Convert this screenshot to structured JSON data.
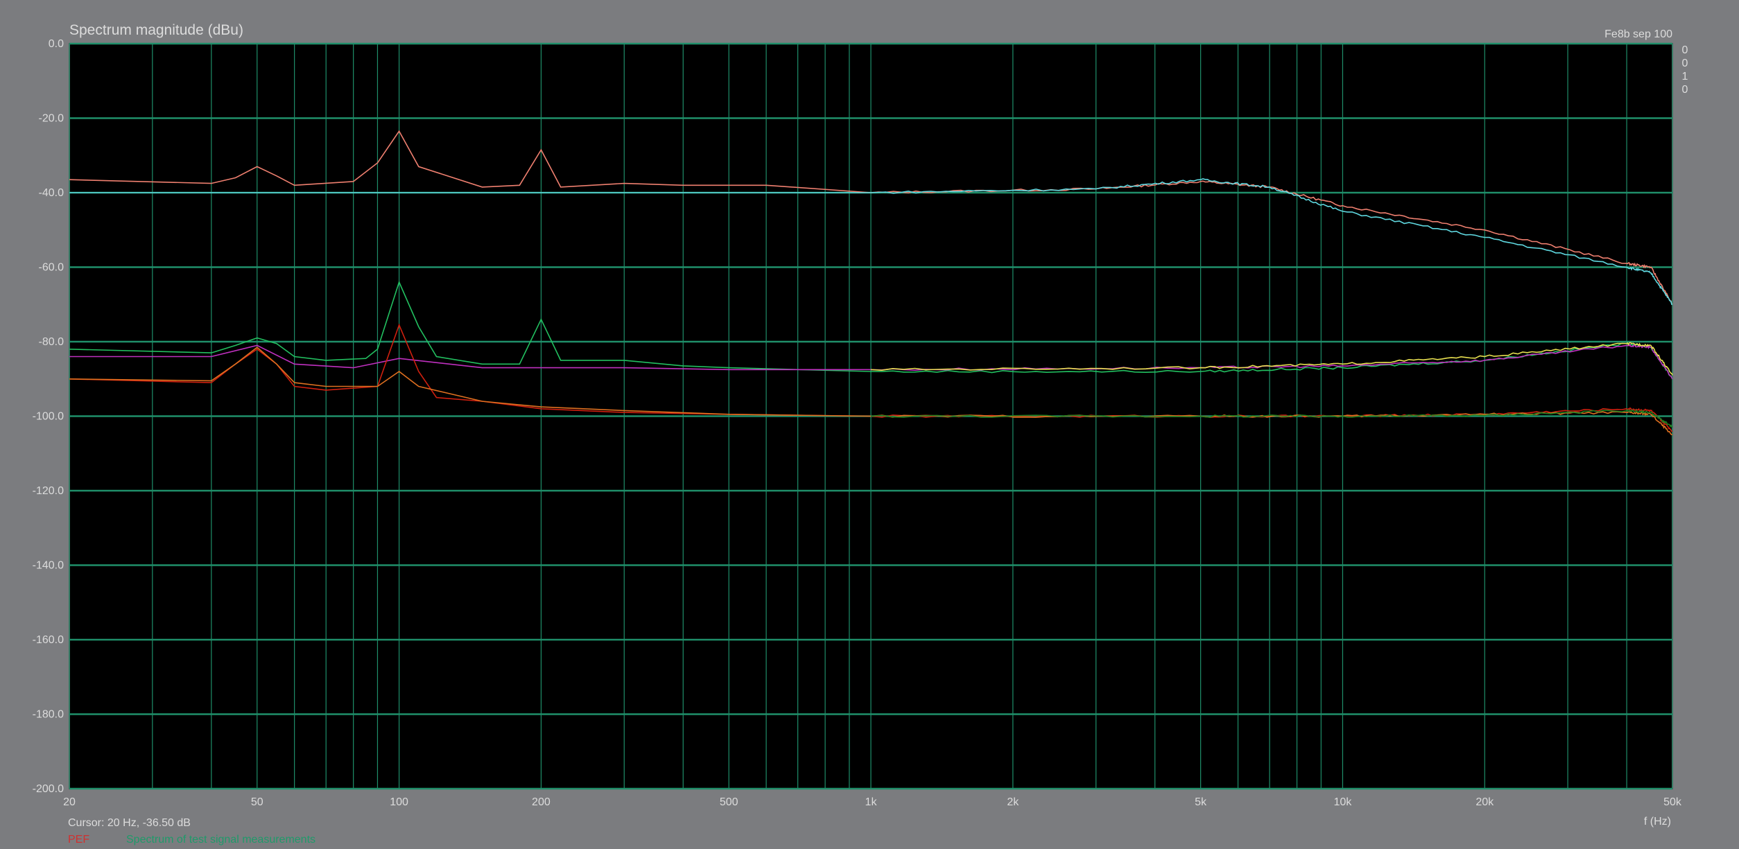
{
  "window": {
    "title": "Spectrum magnitude (dBu)",
    "top_right_label": "Fe8b sep 100"
  },
  "chart_data": {
    "type": "line",
    "title": "Spectrum magnitude (dBu)",
    "xlabel": "f (Hz)",
    "ylabel": "",
    "x_scale": "log",
    "xlim": [
      20,
      50000
    ],
    "ylim": [
      -200,
      0
    ],
    "x_tick_labels": [
      "20",
      "50",
      "100",
      "200",
      "500",
      "1k",
      "2k",
      "5k",
      "10k",
      "20k",
      "50k"
    ],
    "x_tick_values": [
      20,
      50,
      100,
      200,
      500,
      1000,
      2000,
      5000,
      10000,
      20000,
      50000
    ],
    "y_tick_labels": [
      "0.0",
      "-20.0",
      "-40.0",
      "-60.0",
      "-80.0",
      "-100.0",
      "-120.0",
      "-140.0",
      "-160.0",
      "-180.0",
      "-200.0"
    ],
    "y_tick_values": [
      0,
      -20,
      -40,
      -60,
      -80,
      -100,
      -120,
      -140,
      -160,
      -180,
      -200
    ],
    "grid": true,
    "background": "#000000",
    "grid_color": "#1f8f6a",
    "series": [
      {
        "color": "#f08070",
        "x": [
          20,
          40,
          45,
          50,
          55,
          60,
          80,
          90,
          100,
          110,
          150,
          180,
          200,
          220,
          300,
          400,
          500,
          600,
          1000,
          3000,
          5000,
          7000,
          10000,
          20000,
          40000,
          45000,
          50000
        ],
        "y": [
          -36.5,
          -37.5,
          -36,
          -33,
          -35.5,
          -38,
          -37,
          -32,
          -23.5,
          -33,
          -38.5,
          -38,
          -28.5,
          -38.5,
          -37.5,
          -38,
          -38,
          -38,
          -40,
          -39,
          -37,
          -38.5,
          -43.5,
          -50,
          -59,
          -60,
          -70
        ]
      },
      {
        "color": "#5fd8e0",
        "x": [
          20,
          30,
          50,
          100,
          200,
          500,
          1000,
          3000,
          5000,
          7000,
          10000,
          20000,
          40000,
          45000,
          50000
        ],
        "y": [
          -40,
          -40,
          -40,
          -40,
          -40,
          -40,
          -40,
          -39,
          -36.5,
          -38.5,
          -45,
          -52,
          -60,
          -61.5,
          -70
        ]
      },
      {
        "color": "#22c060",
        "x": [
          20,
          40,
          45,
          50,
          55,
          60,
          70,
          85,
          90,
          100,
          110,
          120,
          150,
          180,
          200,
          220,
          300,
          400,
          500,
          1000,
          5000,
          10000,
          20000,
          40000,
          45000,
          50000
        ],
        "y": [
          -82,
          -83,
          -81,
          -79,
          -80.5,
          -84,
          -85,
          -84.5,
          -82,
          -64,
          -76,
          -84,
          -86,
          -86,
          -74,
          -85,
          -85,
          -86.5,
          -87,
          -88,
          -88,
          -87,
          -85,
          -80.5,
          -81.5,
          -90
        ]
      },
      {
        "color": "#c030c0",
        "x": [
          20,
          40,
          50,
          60,
          80,
          100,
          150,
          200,
          300,
          500,
          1000,
          5000,
          10000,
          20000,
          40000,
          45000,
          50000
        ],
        "y": [
          -84,
          -84,
          -81,
          -86,
          -87,
          -84.5,
          -87,
          -87,
          -87,
          -87.5,
          -87.5,
          -87,
          -86.5,
          -85,
          -81,
          -81.5,
          -90
        ]
      },
      {
        "color": "#e8e050",
        "x": [
          1000,
          5000,
          10000,
          20000,
          40000,
          45000,
          50000
        ],
        "y": [
          -87.5,
          -87,
          -86,
          -84,
          -80.5,
          -81,
          -89
        ]
      },
      {
        "color": "#d0200f",
        "x": [
          20,
          40,
          45,
          50,
          55,
          60,
          70,
          90,
          100,
          110,
          120,
          150,
          200,
          300,
          500,
          1000,
          5000,
          10000,
          20000,
          40000,
          45000,
          50000
        ],
        "y": [
          -90,
          -91,
          -86,
          -82,
          -86,
          -92,
          -93,
          -92,
          -75.5,
          -88,
          -95,
          -96,
          -98,
          -99,
          -99.5,
          -100,
          -100,
          -100,
          -99.5,
          -98,
          -98.5,
          -104
        ]
      },
      {
        "color": "#e07020",
        "x": [
          20,
          40,
          45,
          50,
          55,
          60,
          70,
          90,
          100,
          110,
          150,
          200,
          300,
          500,
          1000,
          5000,
          10000,
          20000,
          40000,
          45000,
          50000
        ],
        "y": [
          -90,
          -90.5,
          -86,
          -81.5,
          -86,
          -91,
          -92,
          -92,
          -88,
          -92,
          -96,
          -97.5,
          -98.5,
          -99.5,
          -100,
          -100,
          -100,
          -99.5,
          -99,
          -99.5,
          -105
        ]
      },
      {
        "color": "#208020",
        "x": [
          1000,
          5000,
          10000,
          20000,
          40000,
          45000,
          50000
        ],
        "y": [
          -100,
          -100,
          -100,
          -99.8,
          -98.5,
          -99,
          -103
        ]
      }
    ],
    "cursor_readout": "Cursor: 20 Hz,  -36.50 dB",
    "legend": {
      "position": "bottom-left",
      "labels": [
        "PEF",
        "Spectrum of test signal measurements"
      ]
    },
    "right_edge_marks": [
      "0",
      "0",
      "1",
      "0"
    ]
  }
}
